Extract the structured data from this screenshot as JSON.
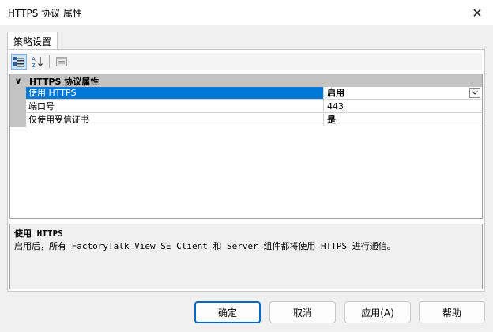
{
  "window": {
    "title": "HTTPS 协议 属性"
  },
  "tab": {
    "label": "策略设置"
  },
  "toolbar": {
    "categorized_icon": "categorized-view-icon",
    "alphabetical_icon": "sort-az-icon",
    "pages_icon": "property-pages-icon"
  },
  "grid": {
    "category": {
      "label": "HTTPS 协议属性",
      "expander_glyph": "∨"
    },
    "rows": [
      {
        "name": "使用 HTTPS",
        "value": "启用",
        "bold": true,
        "selected": true
      },
      {
        "name": "端口号",
        "value": "443",
        "bold": false,
        "selected": false
      },
      {
        "name": "仅使用受信证书",
        "value": "是",
        "bold": true,
        "selected": false
      }
    ]
  },
  "description": {
    "title": "使用 HTTPS",
    "text": "启用后，所有 FactoryTalk View SE Client 和 Server 组件都将使用 HTTPS 进行通信。"
  },
  "buttons": {
    "ok": "确定",
    "cancel": "取消",
    "apply": "应用(A)",
    "help": "帮助"
  },
  "colors": {
    "selection": "#0078d7",
    "accent": "#0067c0"
  }
}
